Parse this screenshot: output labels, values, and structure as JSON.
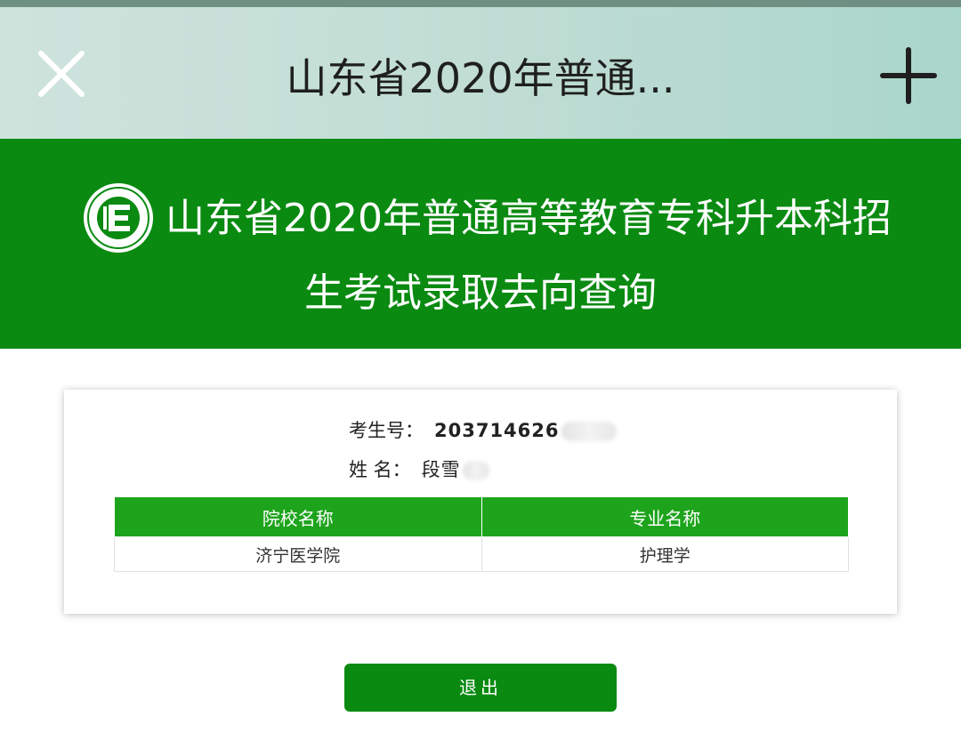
{
  "window": {
    "title": "山东省2020年普通...",
    "close_icon": "close-icon",
    "add_icon": "plus-icon"
  },
  "banner": {
    "logo_icon": "exam-authority-logo",
    "title_line1": "山东省2020年普通高等教育专科升本科招",
    "title_line2": "生考试录取去向查询",
    "background_color": "#0a8a11"
  },
  "student": {
    "id_label": "考生号：",
    "id_value": "203714626",
    "name_label": "姓 名：",
    "name_value": "段雪"
  },
  "result_table": {
    "headers": [
      "院校名称",
      "专业名称"
    ],
    "rows": [
      [
        "济宁医学院",
        "护理学"
      ]
    ],
    "header_color": "#1ea41c"
  },
  "actions": {
    "exit_label": "退出"
  }
}
